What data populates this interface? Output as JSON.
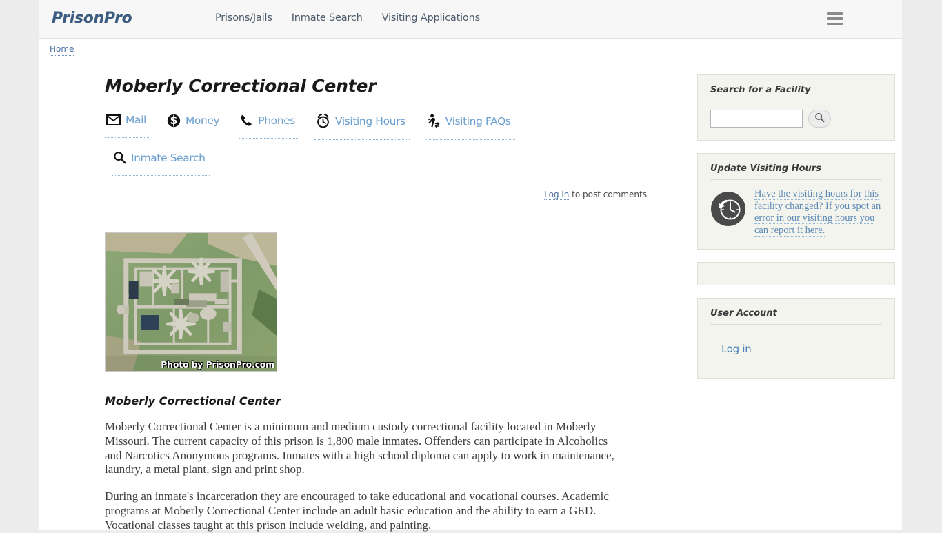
{
  "header": {
    "logo": "PrisonPro",
    "nav": [
      {
        "label": "Prisons/Jails"
      },
      {
        "label": "Inmate Search"
      },
      {
        "label": "Visiting Applications"
      }
    ],
    "menu_icon": "hamburger-icon"
  },
  "breadcrumb": {
    "home": "Home"
  },
  "main": {
    "title": "Moberly Correctional Center",
    "quick_links_row1": [
      {
        "icon": "mail-icon",
        "label": "Mail"
      },
      {
        "icon": "money-icon",
        "label": "Money"
      },
      {
        "icon": "phone-icon",
        "label": "Phones"
      },
      {
        "icon": "alarm-clock-icon",
        "label": "Visiting Hours"
      },
      {
        "icon": "walking-person-icon",
        "label": "Visiting FAQs"
      }
    ],
    "quick_links_row2": [
      {
        "icon": "search-icon",
        "label": "Inmate Search"
      }
    ],
    "comments": {
      "link": "Log in",
      "suffix": " to post comments"
    },
    "photo": {
      "credit": "Photo by PrisonPro.com",
      "alt": "aerial-view-of-prison"
    },
    "body_heading": "Moberly Correctional Center",
    "paragraphs": [
      "Moberly Correctional Center is a minimum and medium custody correctional facility located in Moberly Missouri.  The current capacity of this prison is 1,800 male inmates.  Offenders can participate in Alcoholics and Narcotics Anonymous programs.  Inmates with a high school diploma can apply to work in maintenance, laundry, a metal plant, sign and print shop.",
      "During an inmate's incarceration they are encouraged to take educational and vocational courses.  Academic programs at Moberly Correctional Center include an adult basic education and the ability to earn a GED.  Vocational classes taught at this prison include welding, and painting."
    ]
  },
  "sidebar": {
    "search_panel": {
      "title": "Search for a Facility",
      "input_value": "",
      "input_placeholder": "",
      "button_icon": "search-icon"
    },
    "update_hours_panel": {
      "title": "Update Visiting Hours",
      "icon": "clock-refresh-icon",
      "link_text": "Have the visiting hours for this facility changed?  If you spot an error in our visiting hours you can report it here."
    },
    "user_account_panel": {
      "title": "User Account",
      "login_label": "Log in"
    }
  },
  "colors": {
    "brand": "#3b5c80",
    "link": "#6b9fd0",
    "nav_text": "#4d5b6b",
    "panel_bg": "#f4f4ef",
    "page_bg": "#ececec"
  }
}
